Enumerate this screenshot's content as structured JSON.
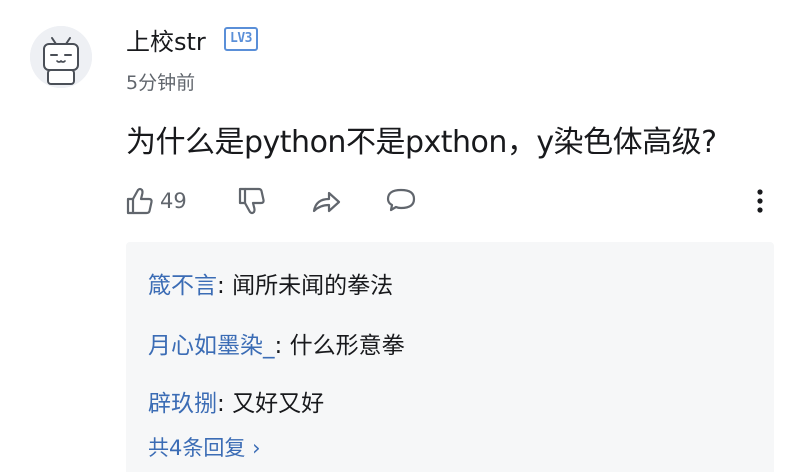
{
  "comment": {
    "author": "上校str",
    "level_badge": "LV3",
    "timestamp": "5分钟前",
    "text": "为什么是python不是pxthon，y染色体高级?",
    "like_count": "49"
  },
  "icons": {
    "like": "thumbs-up-icon",
    "dislike": "thumbs-down-icon",
    "share": "share-arrow-icon",
    "reply": "speech-bubble-icon",
    "more": "vertical-ellipsis-icon"
  },
  "replies": [
    {
      "user": "箴不言",
      "sep": ": ",
      "text": "闻所未闻的拳法"
    },
    {
      "user": "月心如墨染_",
      "sep": ": ",
      "text": "什么形意拳"
    },
    {
      "user": "辟玖捌",
      "sep": ": ",
      "text": "又好又好"
    }
  ],
  "more_replies_label": "共4条回复",
  "more_replies_chevron": "›",
  "colors": {
    "link_blue": "#3b6cb5",
    "badge_blue": "#5a8fd8",
    "muted_text": "#61666d"
  }
}
